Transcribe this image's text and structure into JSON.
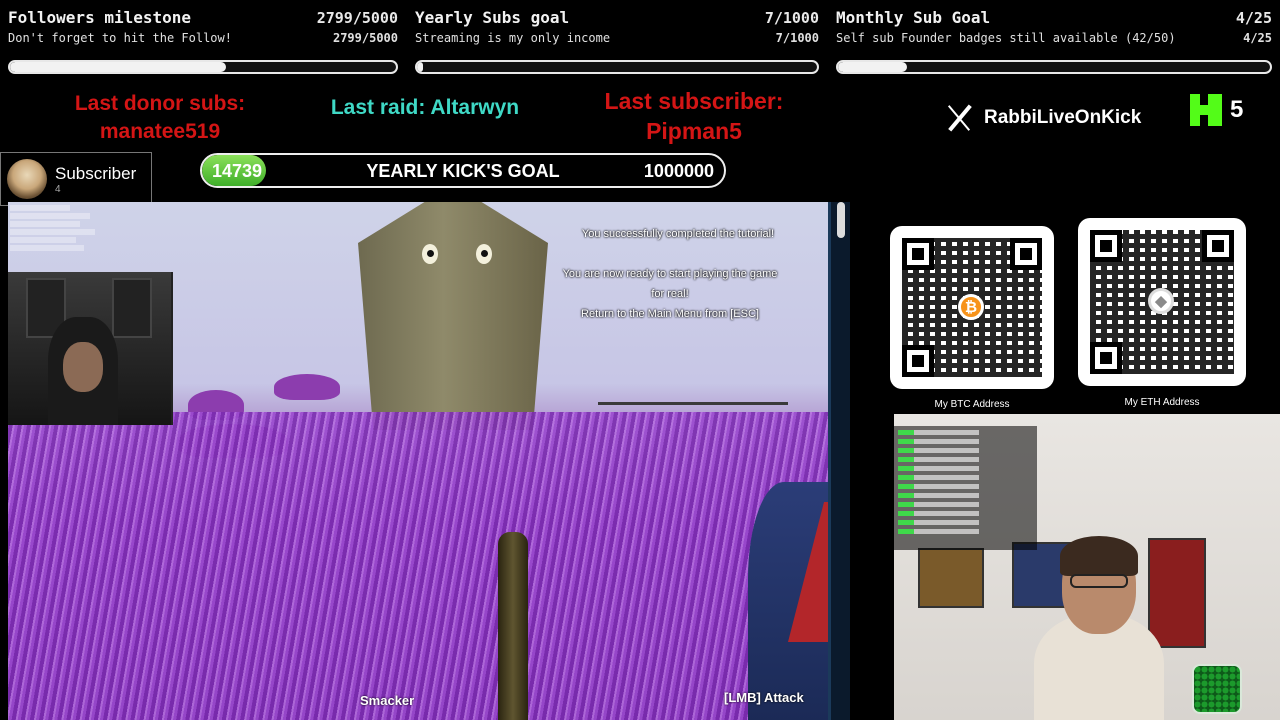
{
  "goals": [
    {
      "title": "Followers milestone",
      "count": "2799/5000",
      "subtitle": "Don't forget to hit the Follow!",
      "subcount": "2799/5000",
      "progress": 0.56
    },
    {
      "title": "Yearly Subs goal",
      "count": "7/1000",
      "subtitle": "Streaming is my only income",
      "subcount": "7/1000",
      "progress": 0.007
    },
    {
      "title": "Monthly Sub Goal",
      "count": "4/25",
      "subtitle": "Self sub Founder badges still available (42/50)",
      "subcount": "4/25",
      "progress": 0.16
    }
  ],
  "alerts": {
    "donor_label": "Last donor subs:",
    "donor_name": "manatee519",
    "raid": "Last raid: Altarwyn",
    "subscriber_label": "Last subscriber:",
    "subscriber_name": "Pipman5"
  },
  "social": {
    "handle": "RabbiLiveOnKick",
    "kick_count": "5"
  },
  "subscriber_badge": {
    "label": "Subscriber",
    "count": "4"
  },
  "kick_goal": {
    "current": "14739",
    "label": "YEARLY KICK'S GOAL",
    "target": "1000000",
    "progress": 0.0147
  },
  "game": {
    "messages": [
      "You successfully completed the tutorial!",
      "You are now ready to start playing the game",
      "for real!",
      "Return to the Main Menu from [ESC]"
    ],
    "weapon_name": "Smacker",
    "attack_hint": "[LMB] Attack"
  },
  "qr": {
    "btc_caption": "My BTC Address",
    "eth_caption": "My ETH Address",
    "btc_symbol": "₿",
    "eth_symbol": "◆"
  },
  "colors": {
    "alert_red": "#d41515",
    "alert_teal": "#3fd9c6",
    "kick_green": "#53fc18",
    "btc_orange": "#f7931a"
  }
}
